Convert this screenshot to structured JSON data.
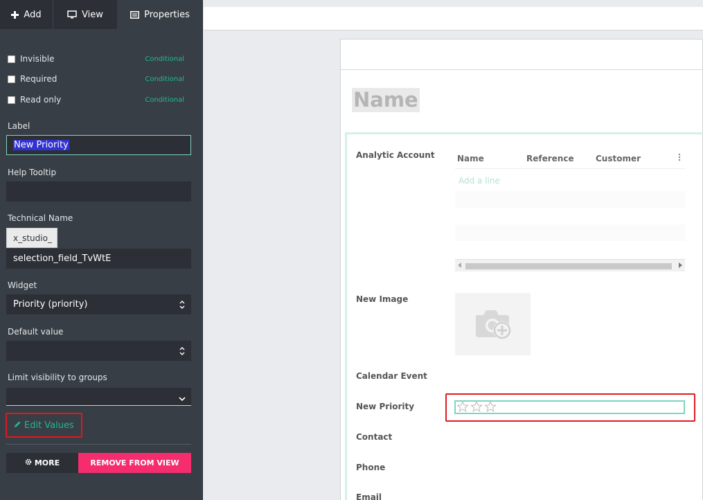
{
  "sidebar": {
    "tabs": [
      {
        "label": "Add",
        "icon": "plus-icon"
      },
      {
        "label": "View",
        "icon": "monitor-icon"
      },
      {
        "label": "Properties",
        "icon": "properties-icon"
      }
    ],
    "checkboxes": [
      {
        "label": "Invisible",
        "checked": false,
        "conditional": "Conditional"
      },
      {
        "label": "Required",
        "checked": false,
        "conditional": "Conditional"
      },
      {
        "label": "Read only",
        "checked": false,
        "conditional": "Conditional"
      }
    ],
    "label_field": {
      "label": "Label",
      "value": "New Priority"
    },
    "help_tooltip": {
      "label": "Help Tooltip",
      "value": ""
    },
    "technical_name": {
      "label": "Technical Name",
      "prefix": "x_studio_",
      "value": "selection_field_TvWtE"
    },
    "widget": {
      "label": "Widget",
      "value": "Priority (priority)"
    },
    "default_value": {
      "label": "Default value",
      "value": ""
    },
    "limit_visibility": {
      "label": "Limit visibility to groups",
      "value": ""
    },
    "edit_values": "Edit Values",
    "more_button": "MORE",
    "remove_button": "REMOVE FROM VIEW",
    "accent_color": "#21b799",
    "remove_color": "#f52d6e"
  },
  "form": {
    "name_placeholder": "Name",
    "fields": {
      "analytic_account": "Analytic Account",
      "new_image": "New Image",
      "calendar_event": "Calendar Event",
      "new_priority": "New Priority",
      "contact": "Contact",
      "phone": "Phone",
      "email": "Email"
    },
    "list": {
      "columns": [
        "Name",
        "Reference",
        "Customer"
      ],
      "add_line": "Add a line"
    },
    "priority_stars": 3,
    "priority_value": 0
  }
}
